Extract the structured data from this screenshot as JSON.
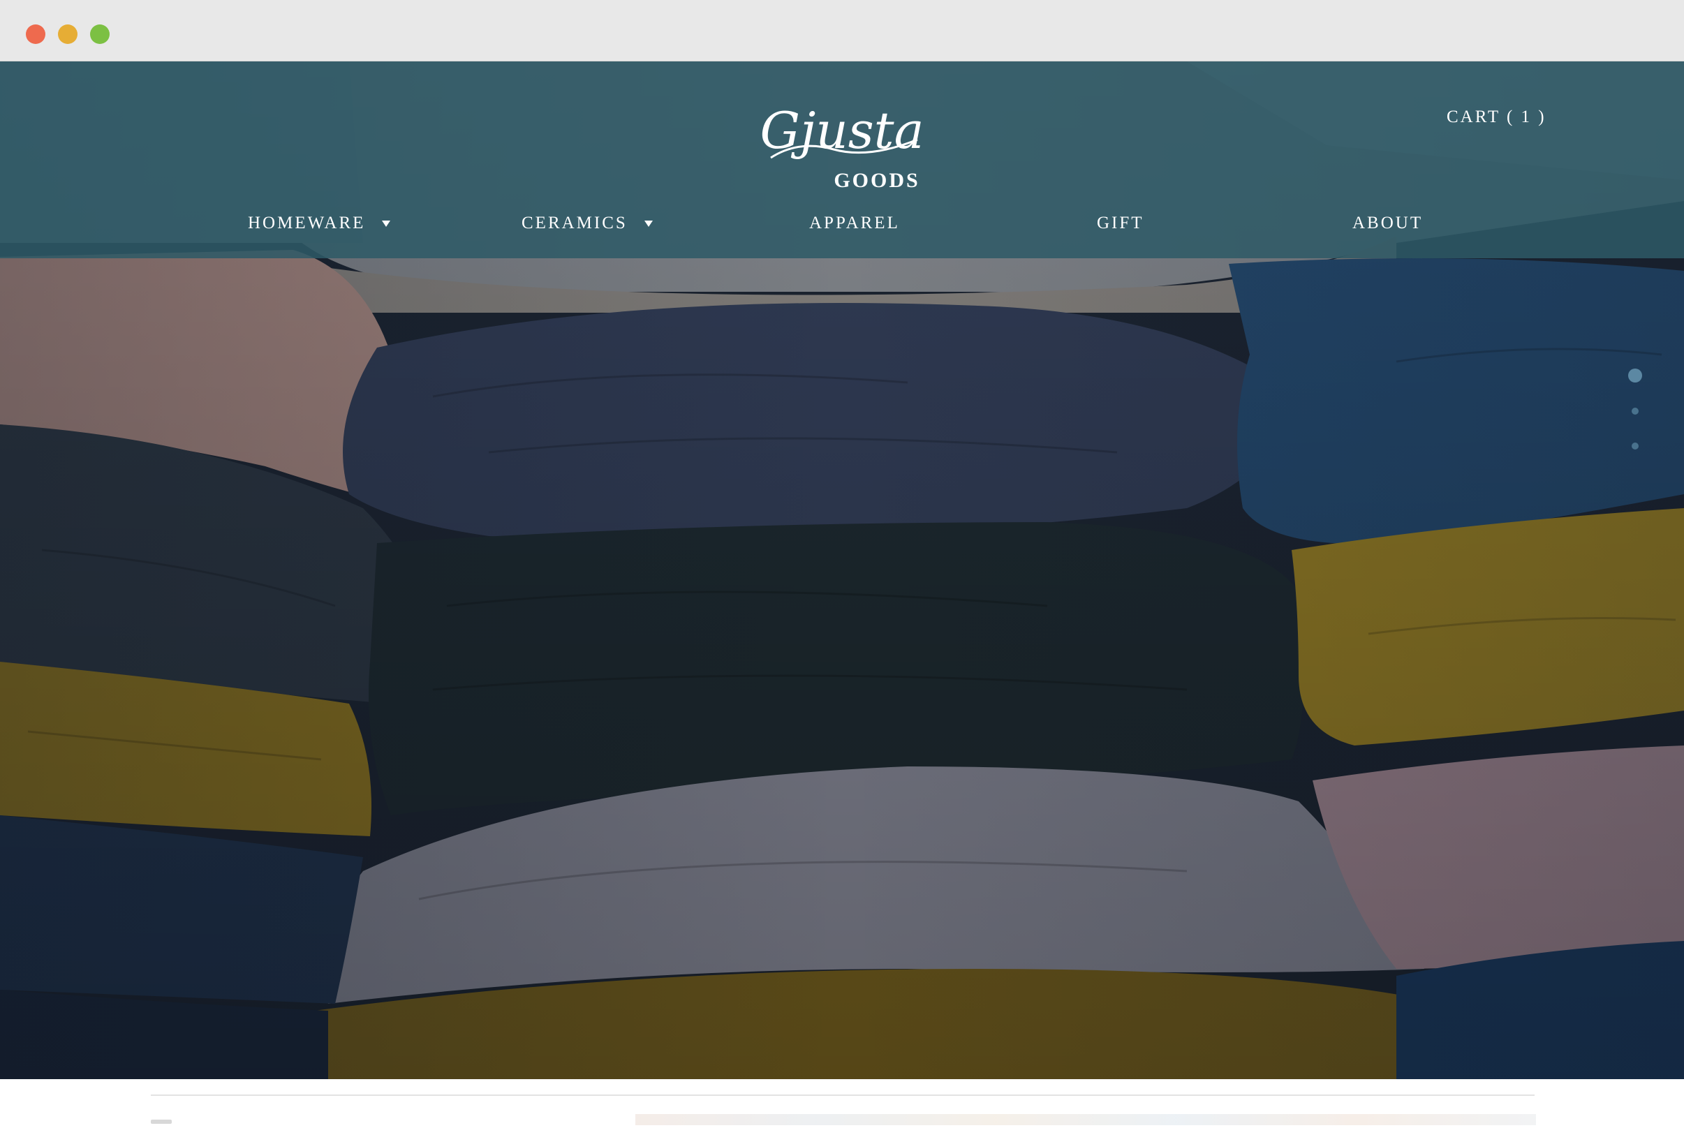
{
  "window": {
    "controls": {
      "close_color": "#ee6a4e",
      "minimize_color": "#e6ad35",
      "maximize_color": "#7cc043"
    }
  },
  "header": {
    "logo": {
      "script_text": "Gjusta",
      "sub_text": "GOODS"
    },
    "cart_label": "CART ( 1 )",
    "bar_color": "#2d5a66"
  },
  "nav": {
    "items": [
      {
        "label": "HOMEWARE",
        "has_dropdown": true
      },
      {
        "label": "CERAMICS",
        "has_dropdown": true
      },
      {
        "label": "APPAREL",
        "has_dropdown": false
      },
      {
        "label": "GIFT",
        "has_dropdown": false
      },
      {
        "label": "ABOUT",
        "has_dropdown": false
      }
    ]
  },
  "hero": {
    "image_subject": "stacked linen pillows",
    "slides_total": 3,
    "active_slide": 1
  }
}
